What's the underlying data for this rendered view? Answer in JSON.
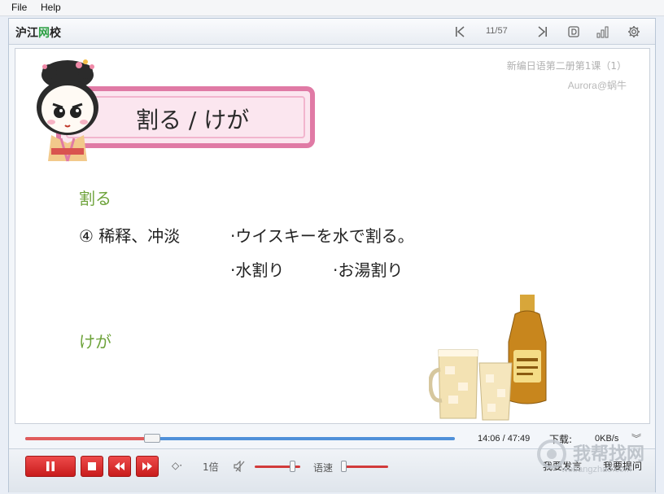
{
  "menu": {
    "file": "File",
    "help": "Help"
  },
  "toolbar": {
    "logo_part1": "沪江",
    "logo_accent": "网",
    "logo_part2": "校",
    "page_indicator": "11/57"
  },
  "slide": {
    "course": "新编日语第二册第1课（1）",
    "author": "Aurora@蜗牛",
    "title": "割る / けが",
    "word1": "割る",
    "meaning": "④ 稀释、冲淡",
    "example1": "·ウイスキーを水で割る。",
    "example2": "·水割り",
    "example3": "·お湯割り",
    "word2": "けが"
  },
  "playback": {
    "current_time": "14:06",
    "total_time": "47:49",
    "time_separator": "/",
    "progress": 0.295,
    "download_label": "下载:",
    "download_speed": "0KB/s",
    "speed_label": "1倍",
    "rate_label": "语速",
    "volume_level": 0.82,
    "rate_level": 0.05,
    "btn_comment": "我要发言",
    "btn_question": "我要提问"
  },
  "watermark": {
    "brand": "我帮找网",
    "url": "wobangzhao.com"
  },
  "colors": {
    "accent_green": "#6ea33b",
    "title_pink": "#e07aa5",
    "control_red": "#d23b3b",
    "progress_blue": "#4f90d9"
  }
}
